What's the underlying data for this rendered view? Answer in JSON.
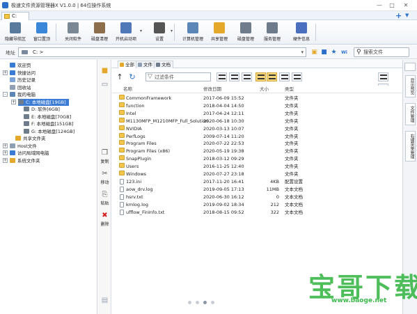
{
  "app": {
    "title": "极速文件资源管理器X V1.0.0 | 64位操作系统"
  },
  "tabs": [
    {
      "label": "C:"
    }
  ],
  "toolbar": {
    "buttons": [
      {
        "label": "隐藏导航区",
        "icon": "hide-nav-icon",
        "color": "#5a7a9c"
      },
      {
        "label": "窗口置顶",
        "icon": "pin-icon",
        "color": "#3a86d8"
      },
      {
        "label": "关闭软件",
        "icon": "close-app-icon",
        "color": "#7a8794"
      },
      {
        "label": "磁盘清理",
        "icon": "disk-clean-icon",
        "color": "#8c6e4a"
      },
      {
        "label": "开机启动项",
        "icon": "startup-icon",
        "color": "#4f78b8"
      },
      {
        "label": "设置",
        "icon": "gear-icon",
        "color": "#555555"
      },
      {
        "label": "计算机管理",
        "icon": "computer-manage-icon",
        "color": "#5c86b6"
      },
      {
        "label": "共享管理",
        "icon": "share-icon",
        "color": "#e4a82a"
      },
      {
        "label": "磁盘管理",
        "icon": "disk-manage-icon",
        "color": "#6e7c8c"
      },
      {
        "label": "服务管理",
        "icon": "service-icon",
        "color": "#6d7b8a"
      },
      {
        "label": "硬件信息",
        "icon": "hardware-icon",
        "color": "#4a6fbf"
      }
    ]
  },
  "address": {
    "label": "地址",
    "path": "C: >",
    "search_placeholder": "搜索文件"
  },
  "tree": {
    "items": [
      {
        "label": "欢迎页",
        "expand": "",
        "color": "#3a7bd5"
      },
      {
        "label": "快捷访问",
        "expand": "+",
        "color": "#3a7bd5"
      },
      {
        "label": "历史记录",
        "expand": "",
        "color": "#7aa4d8"
      },
      {
        "label": "回收站",
        "expand": "",
        "color": "#8fa0b4"
      },
      {
        "label": "我的电脑",
        "expand": "-",
        "color": "#5c86b6"
      },
      {
        "label": "C: 本地磁盘[19GB]",
        "expand": "+",
        "color": "#6e7c8c",
        "selected": true
      },
      {
        "label": "D: 软件[6GB]",
        "expand": "",
        "color": "#6e7c8c"
      },
      {
        "label": "E: 本地磁盘[70GB]",
        "expand": "",
        "color": "#6e7c8c"
      },
      {
        "label": "F: 本地磁盘[151GB]",
        "expand": "",
        "color": "#6e7c8c"
      },
      {
        "label": "G: 本地磁盘[124GB]",
        "expand": "",
        "color": "#6e7c8c"
      },
      {
        "label": "共享文件夹",
        "expand": "",
        "color": "#e4a82a"
      },
      {
        "label": "Host文件",
        "expand": "+",
        "color": "#8fa0b4"
      },
      {
        "label": "访问局域网电脑",
        "expand": "+",
        "color": "#3a7bd5"
      },
      {
        "label": "系统文件夹",
        "expand": "+",
        "color": "#e4a82a"
      }
    ]
  },
  "side_actions": [
    {
      "label": "复制",
      "icon": "copy-icon"
    },
    {
      "label": "移动",
      "icon": "move-icon"
    },
    {
      "label": "粘贴",
      "icon": "paste-icon"
    },
    {
      "label": "删除",
      "icon": "delete-icon"
    }
  ],
  "view_tabs": [
    {
      "label": "全部",
      "active": true,
      "color": "#e4a82a"
    },
    {
      "label": "文件",
      "active": false,
      "color": "#8fa0b4"
    },
    {
      "label": "文档",
      "active": false,
      "color": "#6e7c8c"
    }
  ],
  "filter": {
    "placeholder": "过滤条件"
  },
  "file_list": {
    "columns": [
      "名称",
      "修改日期",
      "大小",
      "类型"
    ],
    "rows": [
      {
        "name": "CommonFramework",
        "date": "2017-06-09 15:52",
        "size": "",
        "type": "文件夹",
        "kind": "folder"
      },
      {
        "name": "function",
        "date": "2018-04-04 14:50",
        "size": "",
        "type": "文件夹",
        "kind": "folder"
      },
      {
        "name": "Intel",
        "date": "2017-04-24 12:11",
        "size": "",
        "type": "文件夹",
        "kind": "folder"
      },
      {
        "name": "M1130MFP_M1210MFP_Full_Solution",
        "date": "2020-06-18 10:30",
        "size": "",
        "type": "文件夹",
        "kind": "folder"
      },
      {
        "name": "NVIDIA",
        "date": "2020-03-13 10:07",
        "size": "",
        "type": "文件夹",
        "kind": "folder"
      },
      {
        "name": "PerfLogs",
        "date": "2009-07-14 11:20",
        "size": "",
        "type": "文件夹",
        "kind": "folder"
      },
      {
        "name": "Program Files",
        "date": "2020-07-22 22:53",
        "size": "",
        "type": "文件夹",
        "kind": "folder"
      },
      {
        "name": "Program Files (x86)",
        "date": "2020-05-19 19:38",
        "size": "",
        "type": "文件夹",
        "kind": "folder"
      },
      {
        "name": "SnapPlugin",
        "date": "2018-03-12 09:29",
        "size": "",
        "type": "文件夹",
        "kind": "folder"
      },
      {
        "name": "Users",
        "date": "2016-11-25 12:40",
        "size": "",
        "type": "文件夹",
        "kind": "folder"
      },
      {
        "name": "Windows",
        "date": "2020-07-27 23:18",
        "size": "",
        "type": "文件夹",
        "kind": "folder"
      },
      {
        "name": "123.ini",
        "date": "2017-11-20 16:41",
        "size": "4KB",
        "type": "配置设置",
        "kind": "file"
      },
      {
        "name": "aow_drv.log",
        "date": "2019-09-05 17:13",
        "size": "11MB",
        "type": "文本文档",
        "kind": "file"
      },
      {
        "name": "hsrv.txt",
        "date": "2020-06-30 16:12",
        "size": "0",
        "type": "文本文档",
        "kind": "file"
      },
      {
        "name": "kmlog.log",
        "date": "2019-09-02 18:34",
        "size": "212",
        "type": "文本文档",
        "kind": "file"
      },
      {
        "name": "ufflow_FinInfo.txt",
        "date": "2018-08-15 09:52",
        "size": "322",
        "type": "文本文档",
        "kind": "file"
      }
    ]
  },
  "right_tabs": [
    {
      "label": "显示预览"
    },
    {
      "label": "文件管理"
    },
    {
      "label": "右键菜单管理"
    }
  ],
  "pager": {
    "pages": 4,
    "current": 3
  },
  "watermark": {
    "text": "宝哥下载",
    "url": "www.baoge.net"
  }
}
